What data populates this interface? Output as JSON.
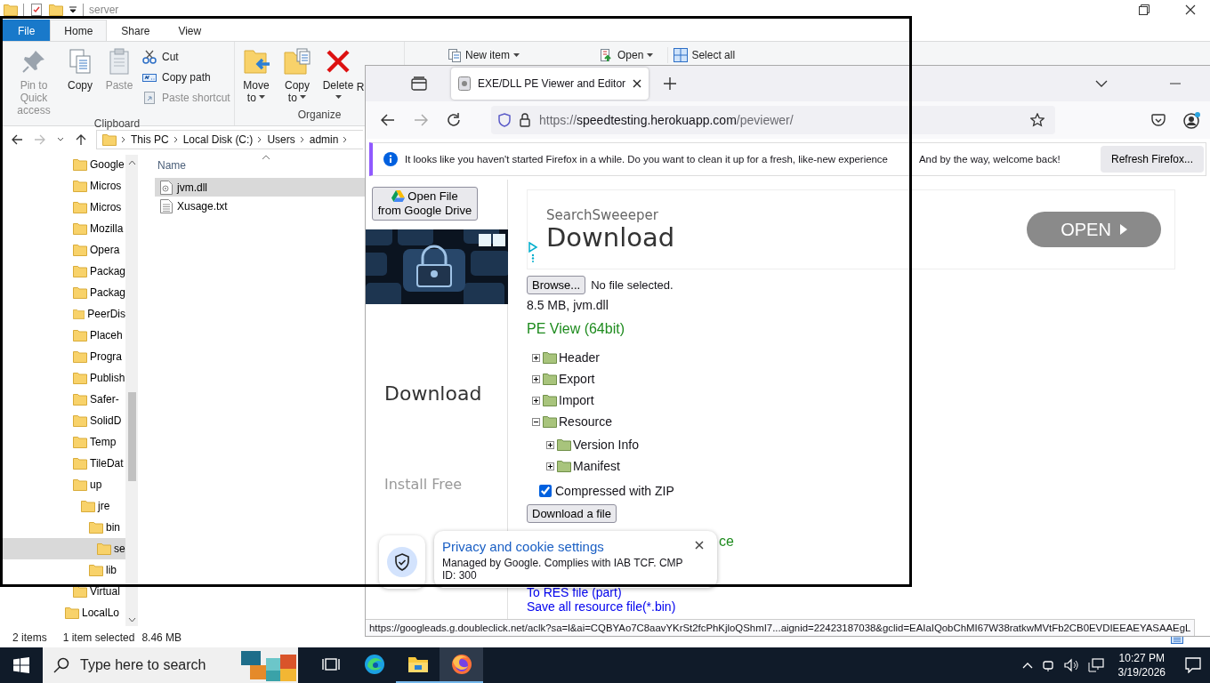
{
  "explorer": {
    "title": "server",
    "ribbon_tabs": [
      {
        "label": "File",
        "kind": "file",
        "selected": false
      },
      {
        "label": "Home",
        "kind": "tab",
        "selected": true
      },
      {
        "label": "Share",
        "kind": "tab",
        "selected": false
      },
      {
        "label": "View",
        "kind": "tab",
        "selected": false
      }
    ],
    "clipboard": {
      "label": "Clipboard",
      "large": [
        {
          "label": "Pin to Quick access",
          "kind": "pin",
          "disabled": true,
          "dropdown": false
        },
        {
          "label": "Copy",
          "kind": "copy",
          "disabled": false,
          "dropdown": false
        },
        {
          "label": "Paste",
          "kind": "paste",
          "disabled": true,
          "dropdown": false
        }
      ],
      "small": [
        {
          "label": "Cut",
          "kind": "cut",
          "disabled": false
        },
        {
          "label": "Copy path",
          "kind": "copy-path",
          "disabled": false
        },
        {
          "label": "Paste shortcut",
          "kind": "paste-shortcut",
          "disabled": true
        }
      ]
    },
    "organize": {
      "label": "Organize",
      "large": [
        {
          "label": "Move to",
          "kind": "move",
          "disabled": false,
          "dropdown": true
        },
        {
          "label": "Copy to",
          "kind": "copy-to",
          "disabled": false,
          "dropdown": true
        },
        {
          "label": "Delete",
          "kind": "delete",
          "disabled": false,
          "dropdown": true
        },
        {
          "label": "R",
          "kind": "partial",
          "disabled": false,
          "dropdown": false
        }
      ]
    },
    "more": [
      {
        "label": "New item",
        "kind": "new-item",
        "dropdown": true
      },
      {
        "label": "Open",
        "kind": "open",
        "dropdown": true
      },
      {
        "label": "Select all",
        "kind": "select-all",
        "dropdown": false
      }
    ],
    "breadcrumb": [
      "This PC",
      "Local Disk (C:)",
      "Users",
      "admin"
    ],
    "nav_tree": [
      {
        "children": [
          {
            "label": "Google",
            "selected": false
          },
          {
            "label": "Micros",
            "selected": false
          },
          {
            "label": "Micros",
            "selected": false
          },
          {
            "label": "Mozilla",
            "selected": false
          },
          {
            "label": "Opera",
            "selected": false
          },
          {
            "label": "Packag",
            "selected": false
          },
          {
            "label": "Packag",
            "selected": false
          },
          {
            "label": "PeerDis",
            "selected": false
          },
          {
            "label": "Placeh",
            "selected": false
          },
          {
            "label": "Progra",
            "selected": false
          },
          {
            "label": "Publish",
            "selected": false
          },
          {
            "label": "Safer-",
            "selected": false
          },
          {
            "label": "SolidD",
            "selected": false
          },
          {
            "label": "Temp",
            "selected": false
          },
          {
            "label": "TileDat",
            "selected": false
          },
          {
            "label": "up",
            "selected": false,
            "children": [
              {
                "label": "jre",
                "selected": false,
                "children": [
                  {
                    "label": "bin",
                    "selected": false,
                    "children": [
                      {
                        "label": "se",
                        "selected": true
                      }
                    ]
                  },
                  {
                    "label": "lib",
                    "selected": false
                  }
                ]
              }
            ]
          },
          {
            "label": "Virtual",
            "selected": false
          }
        ]
      },
      {
        "label": "LocalLo",
        "selected": false
      }
    ],
    "column_header": "Name",
    "files": [
      {
        "name": "jvm.dll",
        "kind": "dll",
        "selected": true
      },
      {
        "name": "Xusage.txt",
        "kind": "txt",
        "selected": false
      }
    ],
    "status": {
      "count": "2 items",
      "selection": "1 item selected",
      "size": "8.46 MB"
    }
  },
  "firefox": {
    "tab_title": "EXE/DLL PE Viewer and Editor",
    "url": {
      "scheme": "https://",
      "host": "speedtesting.herokuapp.com",
      "path": "/peviewer/"
    },
    "notification": {
      "message": "It looks like you haven't started Firefox in a while. Do you want to clean it up for a fresh, like-new experience",
      "message_end": "And by the way, welcome back!",
      "button": "Refresh Firefox..."
    },
    "page": {
      "drive_button": [
        "Open File",
        "from Google Drive"
      ],
      "side_ad": {
        "title": "Download",
        "cta": "Install Free"
      },
      "banner_ad": {
        "brand": "SearchSweeeper",
        "title": "Download",
        "button": "OPEN"
      },
      "file_input": {
        "button": "Browse...",
        "status": "No file selected."
      },
      "file_info": "8.5 MB, jvm.dll",
      "heading": "PE View (64bit)",
      "tree": [
        {
          "label": "Header",
          "expanded": false
        },
        {
          "label": "Export",
          "expanded": false
        },
        {
          "label": "Import",
          "expanded": false
        },
        {
          "label": "Resource",
          "expanded": true,
          "children": [
            {
              "label": "Version Info",
              "expanded": false
            },
            {
              "label": "Manifest",
              "expanded": false
            }
          ]
        }
      ],
      "compressed": {
        "label": "Compressed with ZIP",
        "checked": true
      },
      "download_button": "Download a file",
      "partial_text": "ce",
      "links": [
        "To RES file (part)",
        "Save all resource file(*.bin)"
      ]
    },
    "consent": {
      "title": "Privacy and cookie settings",
      "text": "Managed by Google. Complies with IAB TCF. CMP ID: 300"
    },
    "link_preview": "https://googleads.g.doubleclick.net/aclk?sa=l&ai=CQBYAo7C8aavYKrSt2fcPhKjloQShmI7...aignid=22423187038&gclid=EAIaIQobChMI67W38ratkwMVtFb2CB0EVDIEEAEYASAAEgL"
  },
  "taskbar": {
    "search": {
      "placeholder": "Type here to search"
    },
    "apps": [
      {
        "kind": "task-view",
        "running": false,
        "selected": false
      },
      {
        "kind": "edge",
        "running": false,
        "selected": false
      },
      {
        "kind": "explorer",
        "running": true,
        "selected": false
      },
      {
        "kind": "firefox",
        "running": true,
        "selected": true
      }
    ],
    "time": "10:27 PM",
    "date": "3/19/2026"
  }
}
